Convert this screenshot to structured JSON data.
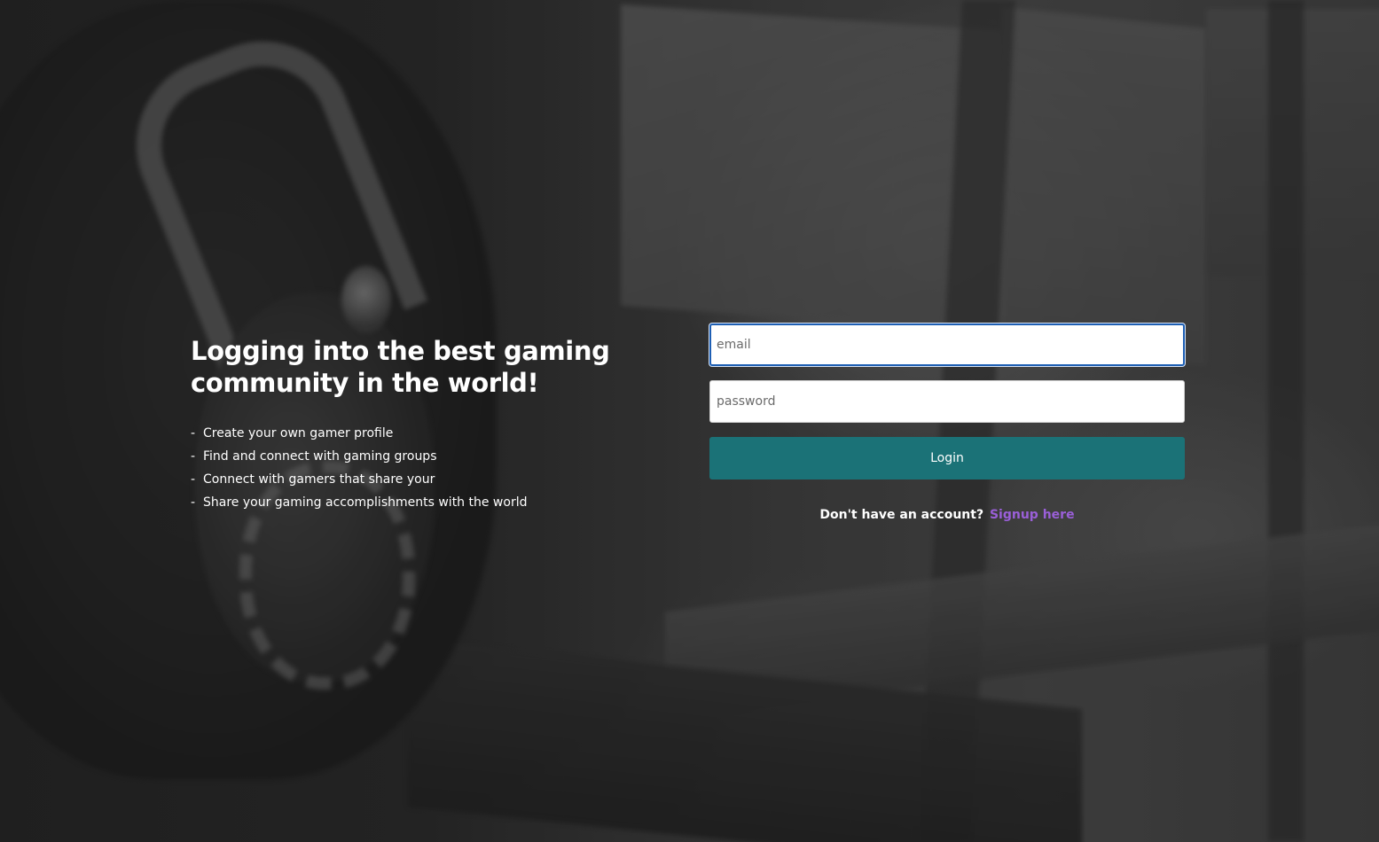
{
  "intro": {
    "heading": "Logging into the best gaming community in the world!",
    "features": [
      "Create your own gamer profile",
      "Find and connect with gaming groups",
      "Connect with gamers that share your",
      "Share your gaming accomplishments with the world"
    ],
    "bullet": "-"
  },
  "login_form": {
    "email_placeholder": "email",
    "email_value": "",
    "password_placeholder": "password",
    "password_value": "",
    "login_label": "Login",
    "signup_prompt": "Don't have an account?",
    "signup_link": "Signup here"
  },
  "colors": {
    "login_button": "#1b7277",
    "signup_link": "#9a5fd8",
    "focus_border": "#1e5fb4",
    "text": "#ffffff"
  }
}
